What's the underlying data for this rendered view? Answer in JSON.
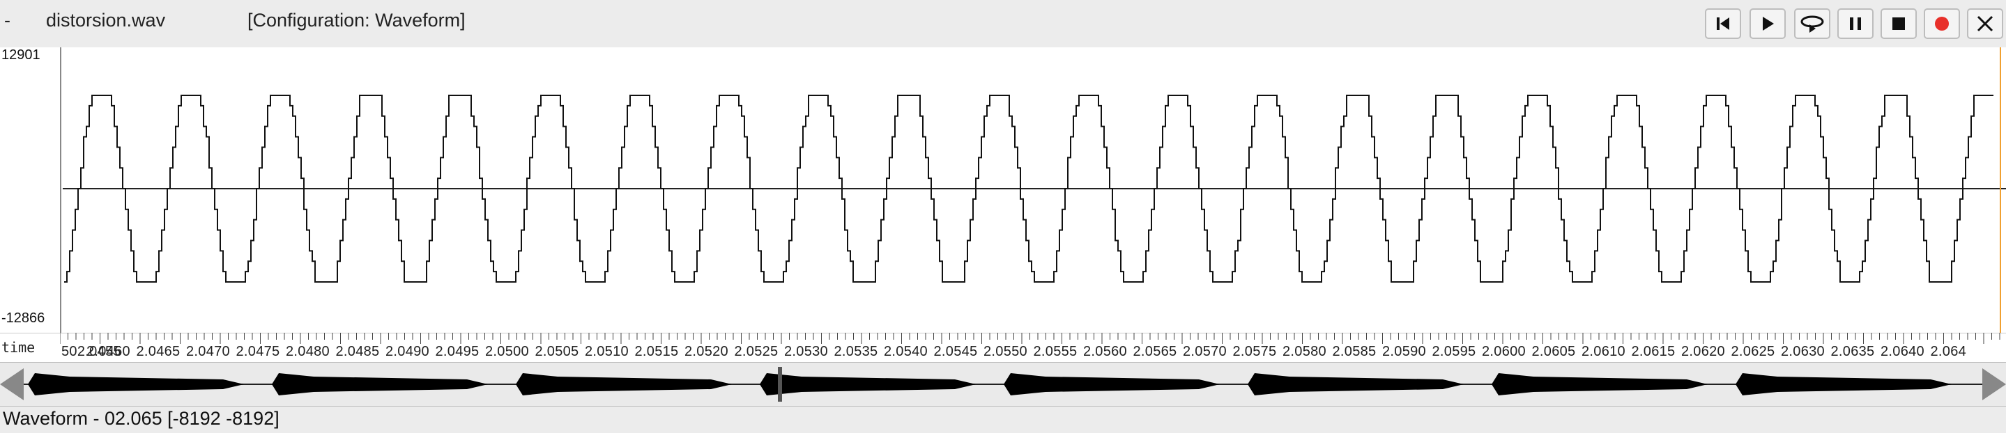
{
  "window": {
    "menu_glyph": "-",
    "file_name": "distorsion.wav",
    "configuration": "[Configuration: Waveform]"
  },
  "controls": [
    {
      "name": "skip-to-start",
      "icon": "skip-back-icon"
    },
    {
      "name": "play",
      "icon": "play-icon"
    },
    {
      "name": "loop",
      "icon": "loop-icon"
    },
    {
      "name": "pause",
      "icon": "pause-icon"
    },
    {
      "name": "stop",
      "icon": "stop-icon"
    },
    {
      "name": "record",
      "icon": "record-icon",
      "color": "#e8302a"
    },
    {
      "name": "close",
      "icon": "close-icon"
    }
  ],
  "plot": {
    "y_max_label": "12901",
    "y_min_label": "-12866",
    "zero_line": true,
    "cursor_color": "#f0a030"
  },
  "time_axis": {
    "label": "time",
    "tick_labels": [
      "502.0455",
      "2.0460",
      "2.0465",
      "2.0470",
      "2.0475",
      "2.0480",
      "2.0485",
      "2.0490",
      "2.0495",
      "2.0500",
      "2.0505",
      "2.0510",
      "2.0515",
      "2.0520",
      "2.0525",
      "2.0530",
      "2.0535",
      "2.0540",
      "2.0545",
      "2.0550",
      "2.0555",
      "2.0560",
      "2.0565",
      "2.0570",
      "2.0575",
      "2.0580",
      "2.0585",
      "2.0590",
      "2.0595",
      "2.0600",
      "2.0605",
      "2.0610",
      "2.0615",
      "2.0620",
      "2.0625",
      "2.0630",
      "2.0635",
      "2.0640",
      "2.064"
    ]
  },
  "status": {
    "text": "Waveform - 02.065 [-8192 -8192]"
  }
}
